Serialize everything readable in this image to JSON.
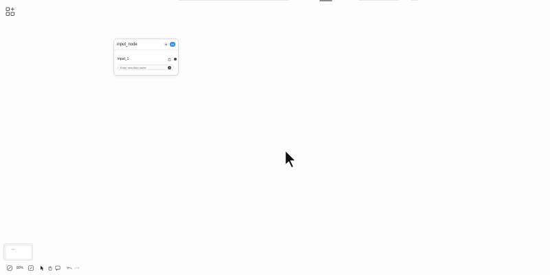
{
  "node": {
    "title": "input_node",
    "badge": "IN",
    "field_label": "input_1",
    "new_field_placeholder": "Enter new field name",
    "new_field_value": ""
  },
  "toolbar": {
    "zoom": "80%"
  },
  "colors": {
    "accent": "#2f8cf0",
    "canvas_bg": "#fdfdfe",
    "node_border": "#dcdde2"
  },
  "icons": {
    "add_node": "shapes-plus-icon",
    "star": "star-icon",
    "trash": "trash-icon",
    "handle": "connection-handle",
    "plus": "plus-circle-icon",
    "cursor": "mouse-pointer",
    "toolbar": [
      "fit-view-icon",
      "zoom-fit-icon",
      "select-pointer-icon",
      "hand-pan-icon",
      "comment-icon",
      "undo-icon",
      "redo-icon"
    ]
  }
}
